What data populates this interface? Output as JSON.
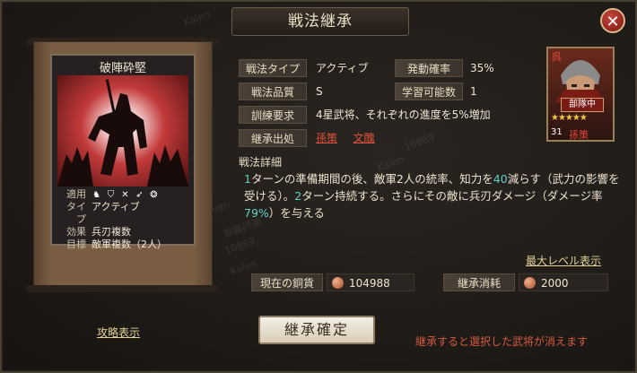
{
  "window": {
    "title": "戦法継承",
    "close_label": "✕"
  },
  "skill_card": {
    "name": "破陣砕堅",
    "rows": [
      {
        "key": "適用",
        "value": ""
      },
      {
        "key": "タイプ",
        "value": "アクティブ"
      },
      {
        "key": "効果",
        "value": "兵刃複数"
      },
      {
        "key": "目標",
        "value": "敵軍複数（2人）"
      }
    ],
    "apply_icons": [
      "horse-icon",
      "shield-icon",
      "crossbow-icon",
      "spear-icon",
      "siege-icon"
    ]
  },
  "properties": [
    {
      "label": "戦法タイプ",
      "value": "アクティブ"
    },
    {
      "label": "発動確率",
      "value": "35%"
    },
    {
      "label": "戦法品質",
      "value": "S"
    },
    {
      "label": "学習可能数",
      "value": "1"
    },
    {
      "label": "訓練要求",
      "value": "4星武将、それぞれの進度を5%増加"
    },
    {
      "label": "継承出処",
      "values": [
        "孫策",
        "文醜"
      ]
    }
  ],
  "detail": {
    "label": "戦法詳細",
    "seg1": "1",
    "seg2": "ターンの準備期間の後、敵軍2人の統率、知力を",
    "seg3": "40",
    "seg4": "減らす（武力の影響を受ける）。",
    "seg5": "2",
    "seg6": "ターン持続する。さらにその敵に兵刃ダメージ（ダメージ率",
    "seg7": "79%",
    "seg8": "）を与える"
  },
  "max_level_link": "最大レベル表示",
  "resources": {
    "copper_label": "現在の銅貨",
    "copper_value": "104988",
    "cost_label": "継承消耗",
    "cost_value": "2000"
  },
  "guide_link": "攻略表示",
  "confirm_button": "継承確定",
  "warning": "継承すると選択した武将が消えます",
  "general": {
    "rank_mark": "呉",
    "tag": "部隊中",
    "stars": "★★★★★",
    "level": "31",
    "name": "孫策"
  },
  "watermarks": [
    "Kalen",
    "10869",
    "ver-",
    "Kalen",
    "10869",
    "Kalen",
    "鎖霸評測"
  ],
  "colors": {
    "accent_red": "#e0523d",
    "highlight": "#5fd1c9",
    "link": "#e4d19a"
  }
}
